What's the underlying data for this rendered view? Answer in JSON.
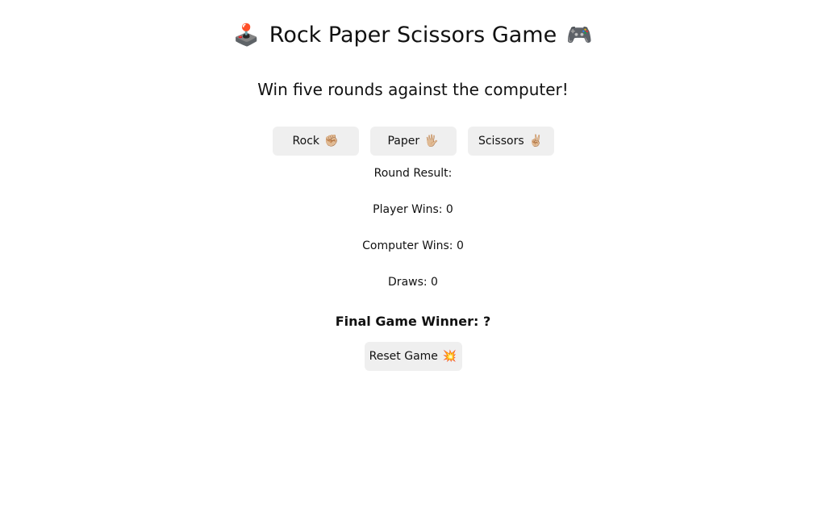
{
  "header": {
    "title": "Rock Paper Scissors Game",
    "left_icon": "joystick-icon",
    "left_icon_glyph": "🕹️",
    "right_icon": "game-controller-icon",
    "right_icon_glyph": "🎮"
  },
  "subtitle": "Win five rounds against the computer!",
  "choices": [
    {
      "label": "Rock",
      "icon": "fist-icon",
      "glyph": "✊🏼"
    },
    {
      "label": "Paper",
      "icon": "raised-hand-icon",
      "glyph": "🖐🏼"
    },
    {
      "label": "Scissors",
      "icon": "victory-hand-icon",
      "glyph": "✌🏼"
    }
  ],
  "stats": {
    "round_result": "Round Result:",
    "player_wins": "Player Wins: 0",
    "computer_wins": "Computer Wins: 0",
    "draws": "Draws: 0"
  },
  "final_winner": "Final Game Winner: ?",
  "reset": {
    "label": "Reset Game",
    "icon": "collision-icon",
    "glyph": "💥"
  },
  "colors": {
    "background": "#ffffff",
    "button_bg": "#efefef",
    "text": "#111111"
  }
}
